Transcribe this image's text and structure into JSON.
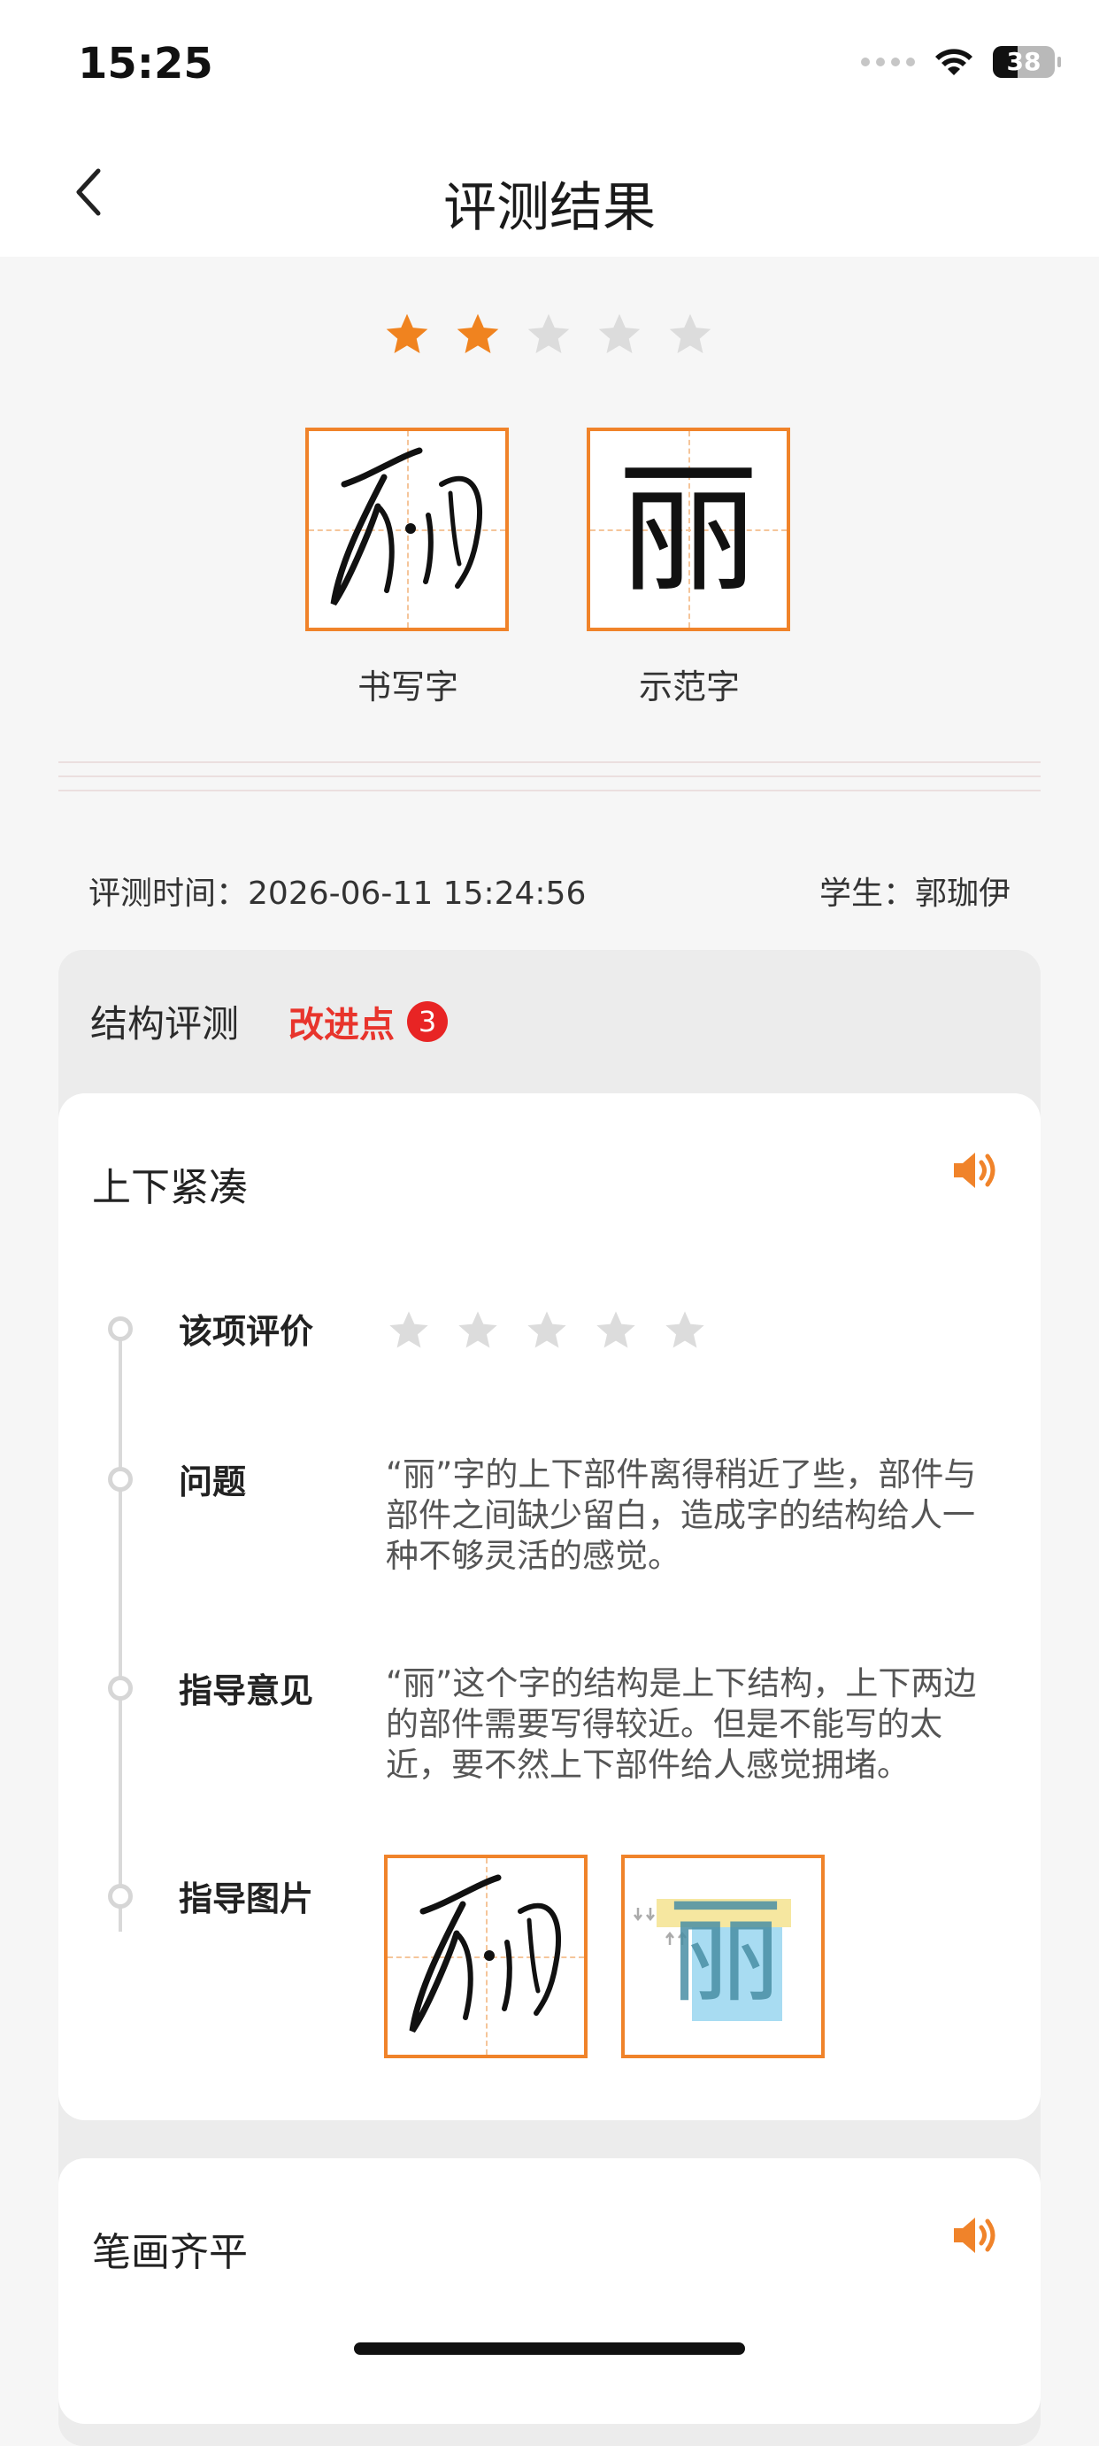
{
  "status_bar": {
    "time": "15:25",
    "battery": "38"
  },
  "nav": {
    "title": "评测结果"
  },
  "overall_rating": {
    "stars": 2,
    "max": 5
  },
  "characters": [
    {
      "label": "书写字"
    },
    {
      "label": "示范字",
      "glyph": "丽"
    }
  ],
  "info": {
    "time_label": "评测时间：",
    "time_value": "2026-06-11 15:24:56",
    "student_label": "学生：",
    "student_name": "郭珈伊"
  },
  "structure_section": {
    "title": "结构评测",
    "improve_label": "改进点",
    "improve_count": "3"
  },
  "cards": [
    {
      "title": "上下紧凑",
      "rating_label": "该项评价",
      "rating": 0,
      "problem_label": "问题",
      "problem_text": "“丽”字的上下部件离得稍近了些，部件与部件之间缺少留白，造成字的结构给人一种不够灵活的感觉。",
      "advice_label": "指导意见",
      "advice_text": "“丽”这个字的结构是上下结构，上下两边的部件需要写得较近。但是不能写的太近，要不然上下部件给人感觉拥堵。",
      "image_label": "指导图片",
      "guide_glyph": "丽"
    },
    {
      "title": "笔画齐平"
    }
  ],
  "colors": {
    "accent": "#f0832a",
    "star_active": "#f0831f",
    "star_inactive": "#dcdcdc",
    "improve": "#e8342c"
  }
}
